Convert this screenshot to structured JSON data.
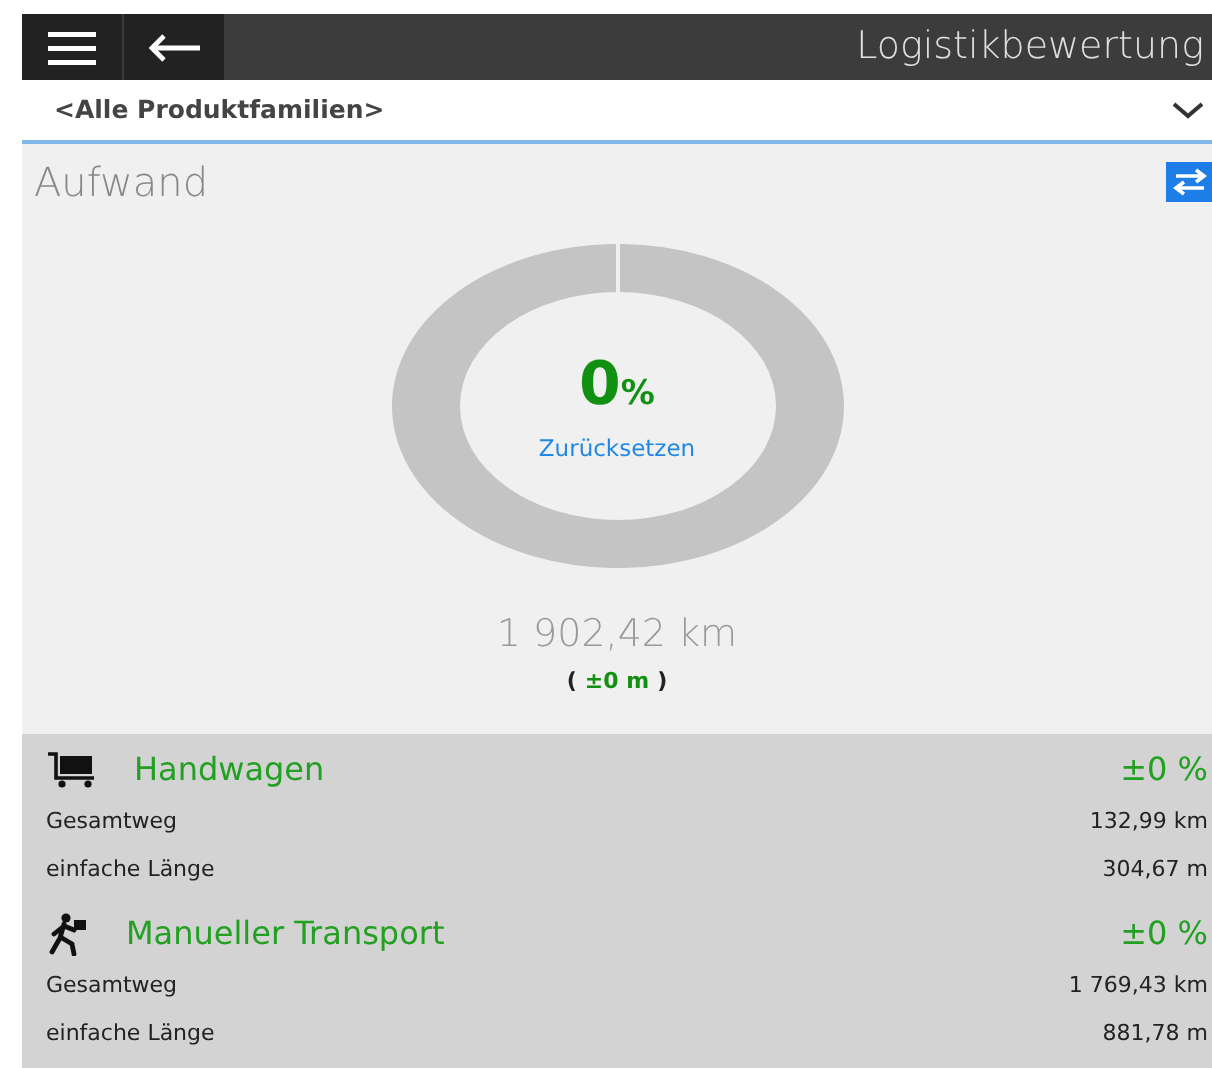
{
  "app_bar": {
    "title": "Logistikbewertung"
  },
  "filter": {
    "value": "<Alle Produktfamilien>"
  },
  "summary": {
    "title": "Aufwand",
    "percent": "0",
    "percent_unit": "%",
    "reset_link": "Zurücksetzen",
    "total": "1 902,42 km",
    "delta_open": "(",
    "delta": "±0 m",
    "delta_close": ")"
  },
  "transports": [
    {
      "kind": "cart",
      "name": "Handwagen",
      "change": "±0 %",
      "rows": [
        {
          "label": "Gesamtweg",
          "value": "132,99 km"
        },
        {
          "label": "einfache Länge",
          "value": "304,67 m"
        }
      ]
    },
    {
      "kind": "walker",
      "name": "Manueller Transport",
      "change": "±0 %",
      "rows": [
        {
          "label": "Gesamtweg",
          "value": "1 769,43 km"
        },
        {
          "label": "einfache Länge",
          "value": "881,78 m"
        }
      ]
    }
  ]
}
